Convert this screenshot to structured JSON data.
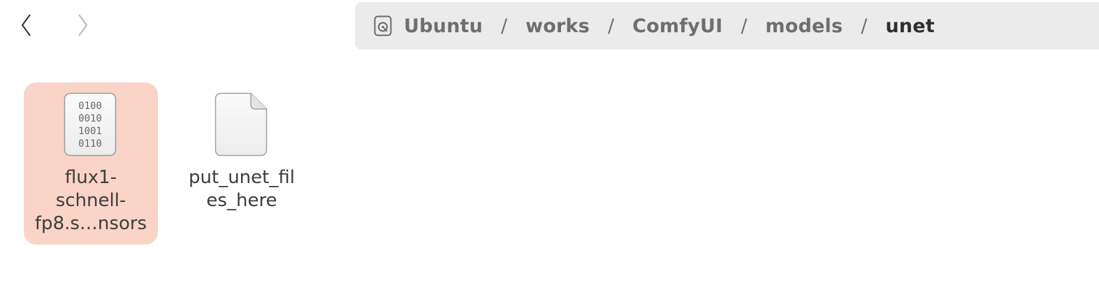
{
  "navigation": {
    "back_icon": "chevron-left-icon",
    "forward_icon": "chevron-right-icon"
  },
  "pathbar": {
    "root_icon": "disk-drive-icon",
    "crumbs": [
      {
        "label": "Ubuntu"
      },
      {
        "label": "works"
      },
      {
        "label": "ComfyUI"
      },
      {
        "label": "models"
      },
      {
        "label": "unet"
      }
    ],
    "separator": "/"
  },
  "files": [
    {
      "name": "flux1-\nschnell-\nfp8.s…nsors",
      "icon": "binary-file-icon",
      "selected": true,
      "icon_text": [
        "0100",
        "0010",
        "1001",
        "0110"
      ]
    },
    {
      "name": "put_unet_fil\nes_here",
      "icon": "blank-file-icon",
      "selected": false
    }
  ],
  "colors": {
    "selection": "#f9d4c7",
    "pathbar_bg": "#ebebeb"
  }
}
